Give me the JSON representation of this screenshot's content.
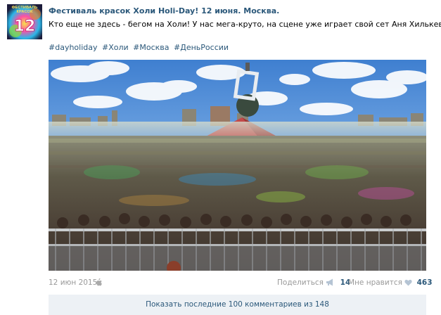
{
  "post": {
    "avatar_text": "ФЕСТИВАЛЬ КРАСОК",
    "author": "Фестиваль красок Холи Holi-Day! 12 июня. Москва.",
    "text": "Кто еще не здесь - бегом на Холи! У нас мега-круто, на сцене уже играет свой сет Аня Хилькевич!",
    "hashtags": [
      "#dayholiday",
      "#Холи",
      "#Москва",
      "#ДеньРоссии"
    ],
    "date": "12 июн 2015",
    "share_label": "Поделиться",
    "share_count": "14",
    "like_label": "Мне нравится",
    "like_count": "463",
    "comments_label": "Показать последние 100 комментариев из 148"
  },
  "icons": {
    "platform": "apple-icon",
    "share": "megaphone-icon",
    "like": "heart-icon"
  },
  "colors": {
    "link": "#2b587a",
    "meta": "#999999",
    "comments_bg": "#edf1f5",
    "like_heart": "#b5c4d4"
  }
}
